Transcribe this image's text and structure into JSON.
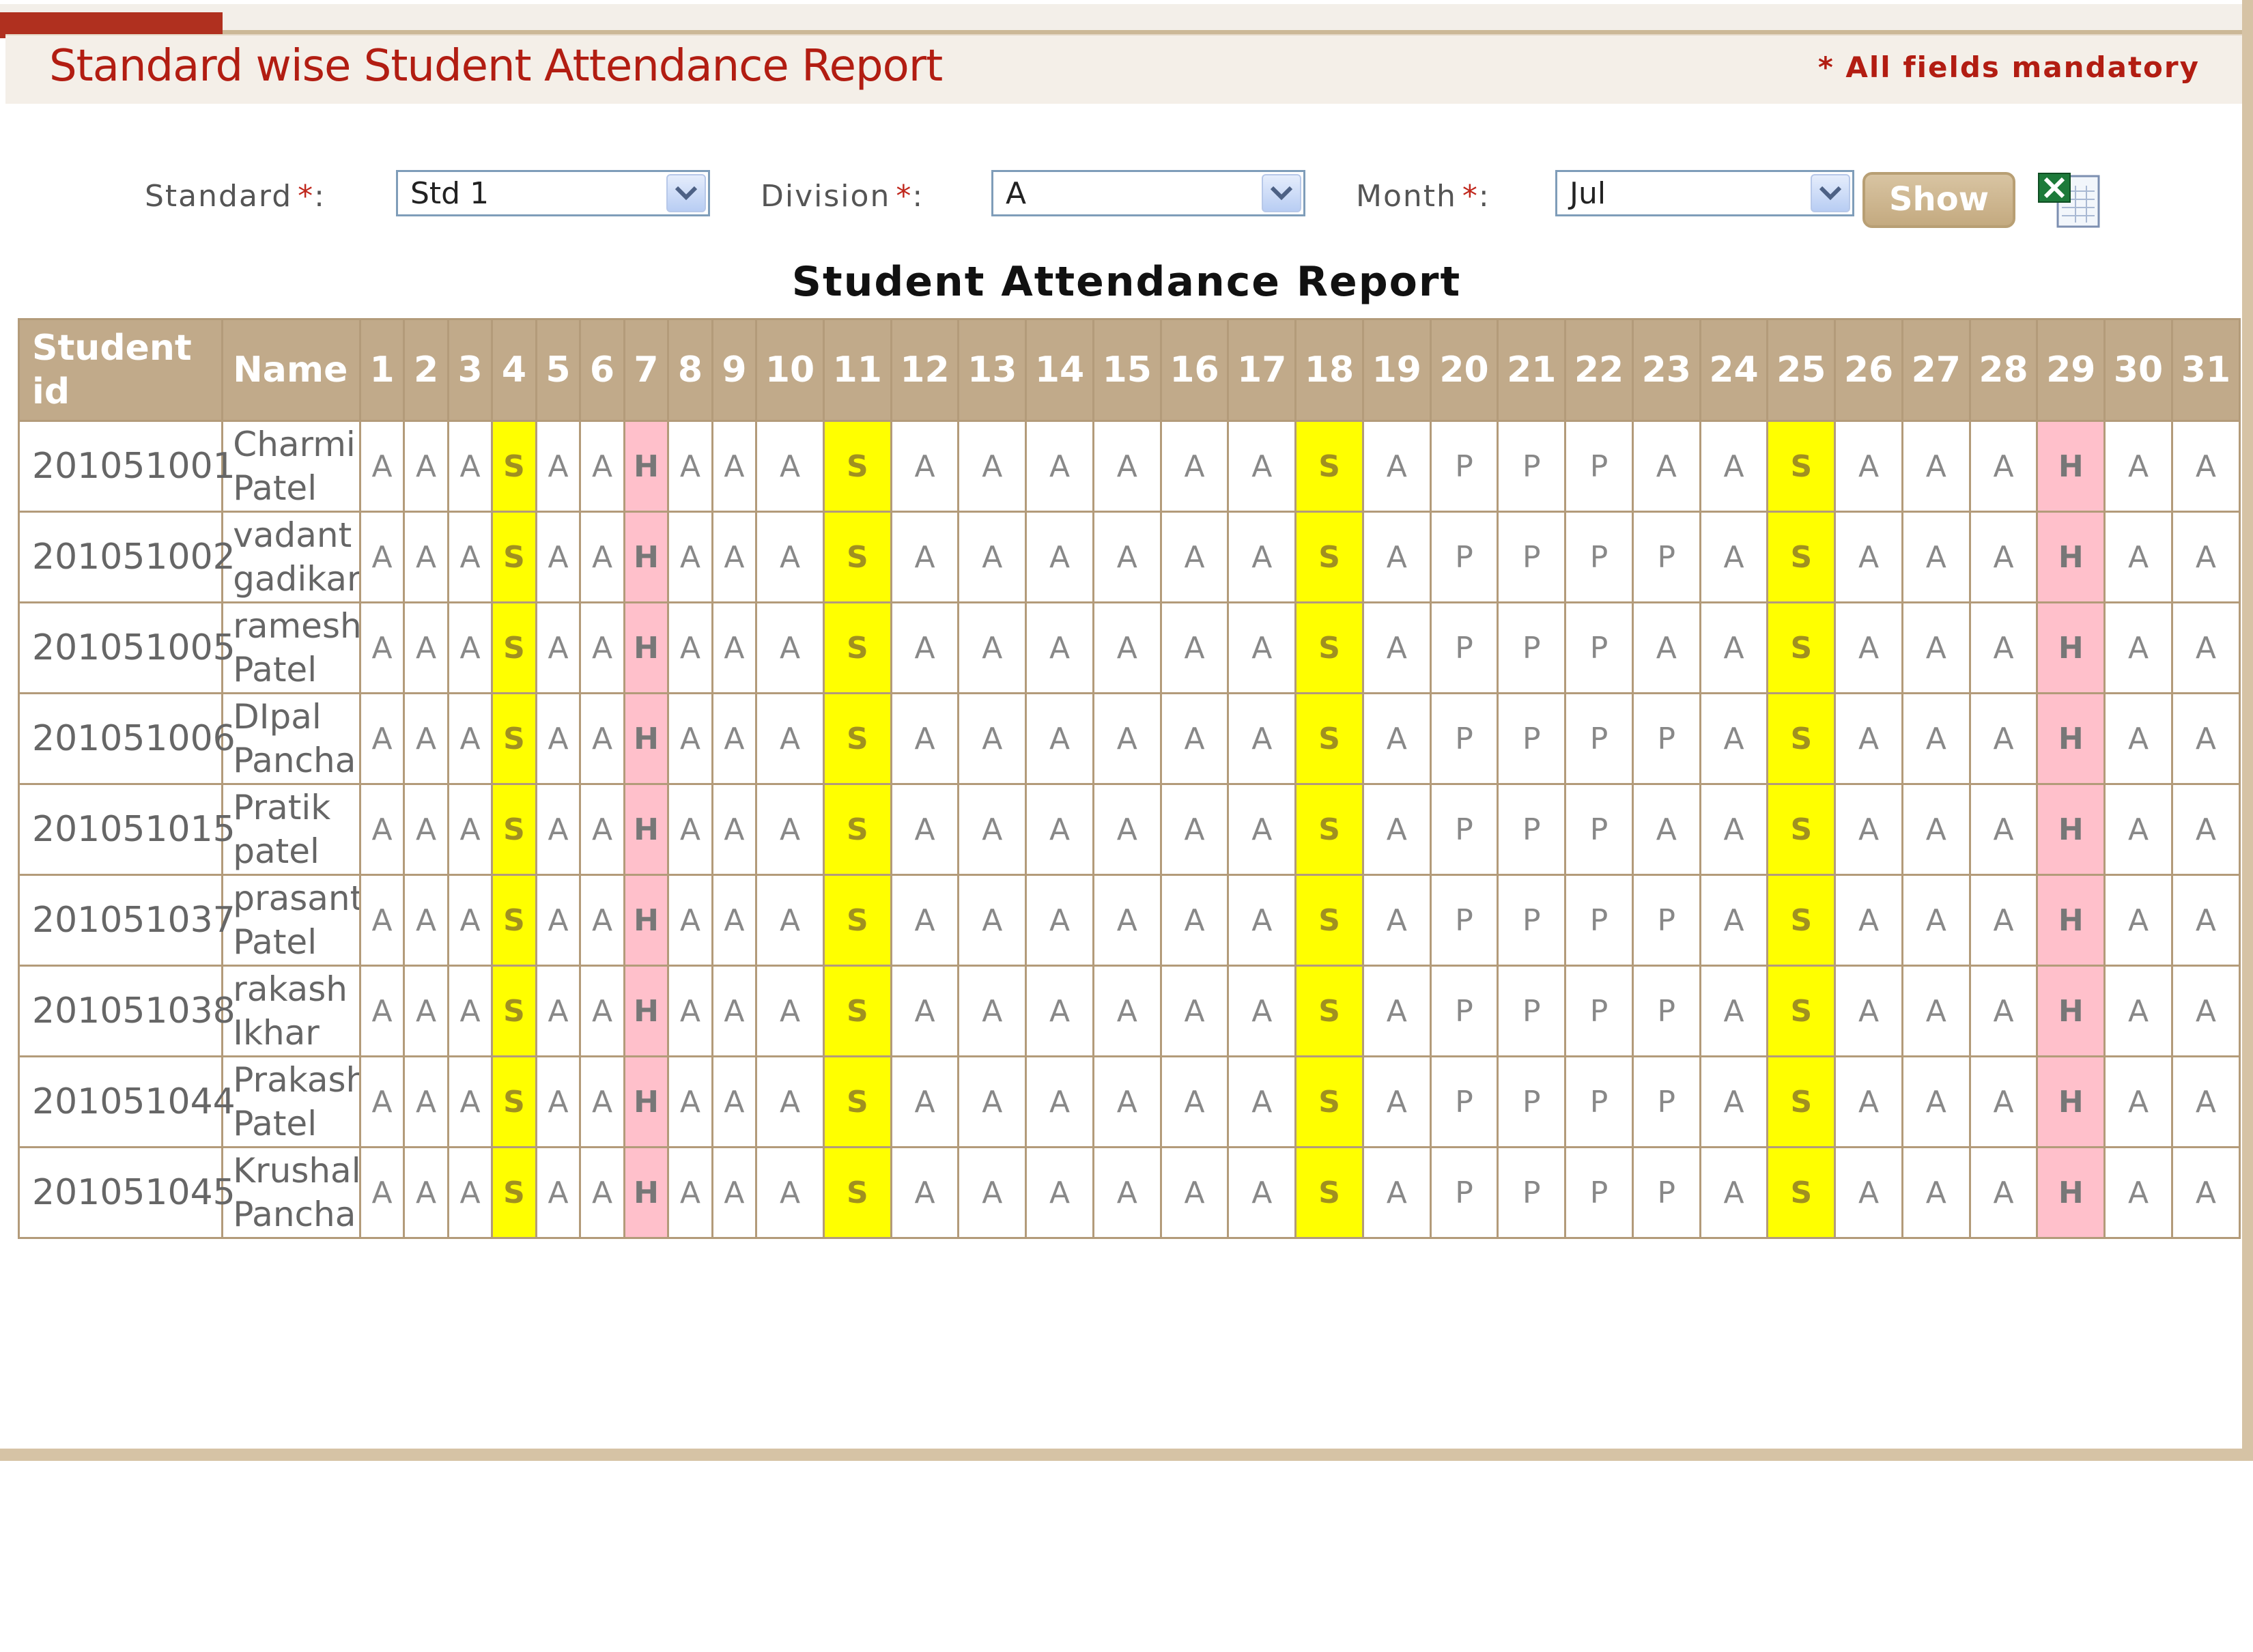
{
  "header": {
    "title": "Standard wise Student Attendance Report",
    "mandatory_note": "* All fields mandatory"
  },
  "filters": {
    "standard": {
      "label": "Standard",
      "required_mark": "*",
      "suffix": ":",
      "value": "Std 1"
    },
    "division": {
      "label": "Division",
      "required_mark": "*",
      "suffix": ":",
      "value": "A"
    },
    "month": {
      "label": "Month",
      "required_mark": "*",
      "suffix": ":",
      "value": "Jul"
    },
    "show_label": "Show"
  },
  "report": {
    "heading": "Student Attendance Report",
    "columns": {
      "student_id": "Student id",
      "name": "Name",
      "days": [
        "1",
        "2",
        "3",
        "4",
        "5",
        "6",
        "7",
        "8",
        "9",
        "10",
        "11",
        "12",
        "13",
        "14",
        "15",
        "16",
        "17",
        "18",
        "19",
        "20",
        "21",
        "22",
        "23",
        "24",
        "25",
        "26",
        "27",
        "28",
        "29",
        "30",
        "31"
      ]
    },
    "rows": [
      {
        "id": "201051001",
        "first": "Charmi",
        "last": "Patel",
        "marks": [
          "A",
          "A",
          "A",
          "S",
          "A",
          "A",
          "H",
          "A",
          "A",
          "A",
          "S",
          "A",
          "A",
          "A",
          "A",
          "A",
          "A",
          "S",
          "A",
          "P",
          "P",
          "P",
          "A",
          "A",
          "S",
          "A",
          "A",
          "A",
          "H",
          "A",
          "A"
        ]
      },
      {
        "id": "201051002",
        "first": "vadant",
        "last": "gadikar",
        "marks": [
          "A",
          "A",
          "A",
          "S",
          "A",
          "A",
          "H",
          "A",
          "A",
          "A",
          "S",
          "A",
          "A",
          "A",
          "A",
          "A",
          "A",
          "S",
          "A",
          "P",
          "P",
          "P",
          "P",
          "A",
          "S",
          "A",
          "A",
          "A",
          "H",
          "A",
          "A"
        ]
      },
      {
        "id": "201051005",
        "first": "ramesh",
        "last": "Patel",
        "marks": [
          "A",
          "A",
          "A",
          "S",
          "A",
          "A",
          "H",
          "A",
          "A",
          "A",
          "S",
          "A",
          "A",
          "A",
          "A",
          "A",
          "A",
          "S",
          "A",
          "P",
          "P",
          "P",
          "A",
          "A",
          "S",
          "A",
          "A",
          "A",
          "H",
          "A",
          "A"
        ]
      },
      {
        "id": "201051006",
        "first": "DIpal",
        "last": "Panchal",
        "marks": [
          "A",
          "A",
          "A",
          "S",
          "A",
          "A",
          "H",
          "A",
          "A",
          "A",
          "S",
          "A",
          "A",
          "A",
          "A",
          "A",
          "A",
          "S",
          "A",
          "P",
          "P",
          "P",
          "P",
          "A",
          "S",
          "A",
          "A",
          "A",
          "H",
          "A",
          "A"
        ]
      },
      {
        "id": "201051015",
        "first": "Pratik",
        "last": "patel",
        "marks": [
          "A",
          "A",
          "A",
          "S",
          "A",
          "A",
          "H",
          "A",
          "A",
          "A",
          "S",
          "A",
          "A",
          "A",
          "A",
          "A",
          "A",
          "S",
          "A",
          "P",
          "P",
          "P",
          "A",
          "A",
          "S",
          "A",
          "A",
          "A",
          "H",
          "A",
          "A"
        ]
      },
      {
        "id": "201051037",
        "first": "prasant",
        "last": "Patel",
        "marks": [
          "A",
          "A",
          "A",
          "S",
          "A",
          "A",
          "H",
          "A",
          "A",
          "A",
          "S",
          "A",
          "A",
          "A",
          "A",
          "A",
          "A",
          "S",
          "A",
          "P",
          "P",
          "P",
          "P",
          "A",
          "S",
          "A",
          "A",
          "A",
          "H",
          "A",
          "A"
        ]
      },
      {
        "id": "201051038",
        "first": "rakash",
        "last": "Ikhar",
        "marks": [
          "A",
          "A",
          "A",
          "S",
          "A",
          "A",
          "H",
          "A",
          "A",
          "A",
          "S",
          "A",
          "A",
          "A",
          "A",
          "A",
          "A",
          "S",
          "A",
          "P",
          "P",
          "P",
          "P",
          "A",
          "S",
          "A",
          "A",
          "A",
          "H",
          "A",
          "A"
        ]
      },
      {
        "id": "201051044",
        "first": "Prakash",
        "last": "Patel",
        "marks": [
          "A",
          "A",
          "A",
          "S",
          "A",
          "A",
          "H",
          "A",
          "A",
          "A",
          "S",
          "A",
          "A",
          "A",
          "A",
          "A",
          "A",
          "S",
          "A",
          "P",
          "P",
          "P",
          "P",
          "A",
          "S",
          "A",
          "A",
          "A",
          "H",
          "A",
          "A"
        ]
      },
      {
        "id": "201051045",
        "first": "Krushali",
        "last": "Panchal",
        "marks": [
          "A",
          "A",
          "A",
          "S",
          "A",
          "A",
          "H",
          "A",
          "A",
          "A",
          "S",
          "A",
          "A",
          "A",
          "A",
          "A",
          "A",
          "S",
          "A",
          "P",
          "P",
          "P",
          "P",
          "A",
          "S",
          "A",
          "A",
          "A",
          "H",
          "A",
          "A"
        ]
      }
    ]
  },
  "icons": {
    "excel": "excel-export-icon",
    "dropdown": "chevron-down-icon"
  },
  "colors": {
    "title": "#b21d12",
    "header_bg": "#c1aa8a",
    "sunday_bg": "#ffff00",
    "holiday_bg": "#ffc0cb",
    "border": "#b39b7a"
  }
}
